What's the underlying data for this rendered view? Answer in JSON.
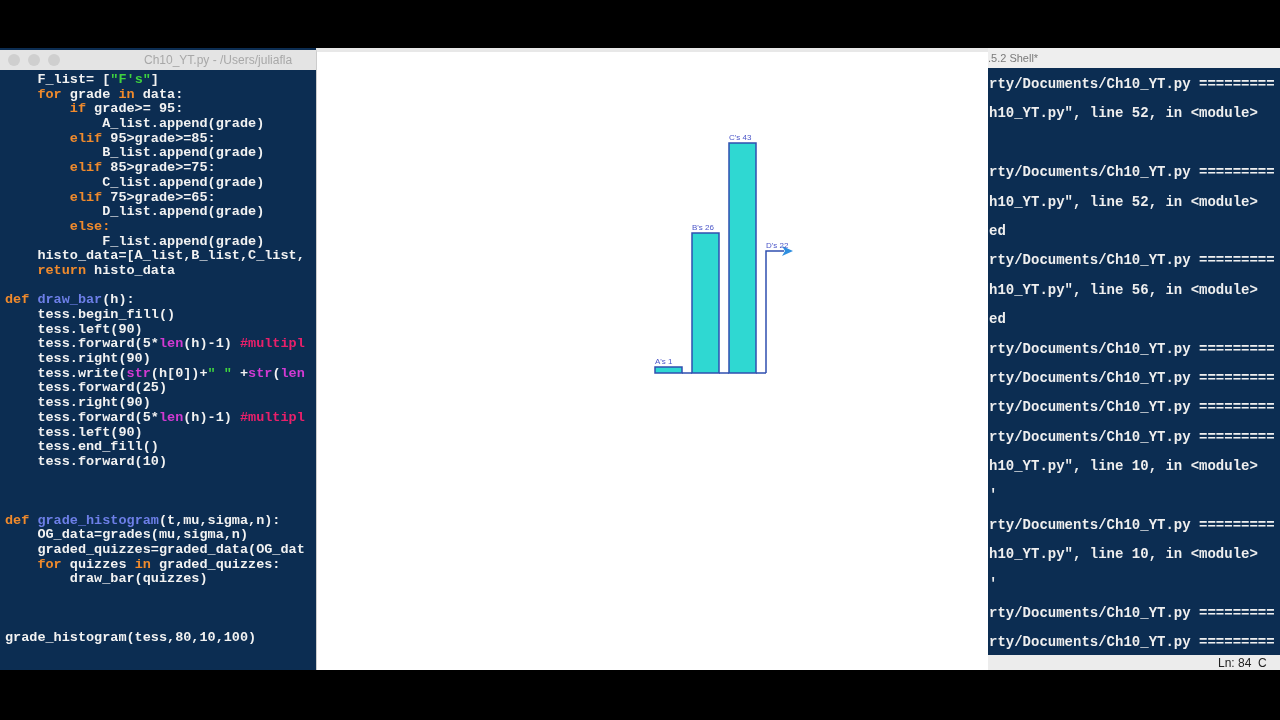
{
  "editor": {
    "title": "Ch10_YT.py - /Users/juliafla",
    "lines": [
      {
        "kind": "code",
        "tokens": [
          {
            "kind": "plain",
            "text": "    F_list= ["
          },
          {
            "kind": "string",
            "text": "\"F's\""
          },
          {
            "kind": "plain",
            "text": "]"
          }
        ]
      },
      {
        "kind": "code",
        "tokens": [
          {
            "kind": "keyword",
            "text": "    for"
          },
          {
            "kind": "plain",
            "text": " grade "
          },
          {
            "kind": "keyword",
            "text": "in"
          },
          {
            "kind": "plain",
            "text": " data:"
          }
        ]
      },
      {
        "kind": "code",
        "tokens": [
          {
            "kind": "keyword",
            "text": "        if"
          },
          {
            "kind": "plain",
            "text": " grade>= 95:"
          }
        ]
      },
      {
        "kind": "code",
        "tokens": [
          {
            "kind": "plain",
            "text": "            A_list.append(grade)"
          }
        ]
      },
      {
        "kind": "code",
        "tokens": [
          {
            "kind": "keyword",
            "text": "        elif"
          },
          {
            "kind": "plain",
            "text": " 95>grade>=85:"
          }
        ]
      },
      {
        "kind": "code",
        "tokens": [
          {
            "kind": "plain",
            "text": "            B_list.append(grade)"
          }
        ]
      },
      {
        "kind": "code",
        "tokens": [
          {
            "kind": "keyword",
            "text": "        elif"
          },
          {
            "kind": "plain",
            "text": " 85>grade>=75:"
          }
        ]
      },
      {
        "kind": "code",
        "tokens": [
          {
            "kind": "plain",
            "text": "            C_list.append(grade)"
          }
        ]
      },
      {
        "kind": "code",
        "tokens": [
          {
            "kind": "keyword",
            "text": "        elif"
          },
          {
            "kind": "plain",
            "text": " 75>grade>=65:"
          }
        ]
      },
      {
        "kind": "code",
        "tokens": [
          {
            "kind": "plain",
            "text": "            D_list.append(grade)"
          }
        ]
      },
      {
        "kind": "code",
        "tokens": [
          {
            "kind": "keyword",
            "text": "        else:"
          }
        ]
      },
      {
        "kind": "code",
        "tokens": [
          {
            "kind": "plain",
            "text": "            F_list.append(grade)"
          }
        ]
      },
      {
        "kind": "code",
        "tokens": [
          {
            "kind": "plain",
            "text": "    histo_data=[A_list,B_list,C_list,"
          }
        ]
      },
      {
        "kind": "code",
        "tokens": [
          {
            "kind": "keyword",
            "text": "    return"
          },
          {
            "kind": "plain",
            "text": " histo_data"
          }
        ]
      },
      {
        "kind": "blank"
      },
      {
        "kind": "code",
        "tokens": [
          {
            "kind": "keyword",
            "text": "def"
          },
          {
            "kind": "defname",
            "text": " draw_bar"
          },
          {
            "kind": "plain",
            "text": "(h):"
          }
        ]
      },
      {
        "kind": "code",
        "tokens": [
          {
            "kind": "plain",
            "text": "    tess.begin_fill()"
          }
        ]
      },
      {
        "kind": "code",
        "tokens": [
          {
            "kind": "plain",
            "text": "    tess.left(90)"
          }
        ]
      },
      {
        "kind": "code",
        "tokens": [
          {
            "kind": "plain",
            "text": "    tess.forward(5*"
          },
          {
            "kind": "builtin",
            "text": "len"
          },
          {
            "kind": "plain",
            "text": "(h)-1) "
          },
          {
            "kind": "comment",
            "text": "#multipl"
          }
        ]
      },
      {
        "kind": "code",
        "tokens": [
          {
            "kind": "plain",
            "text": "    tess.right(90)"
          }
        ]
      },
      {
        "kind": "code",
        "tokens": [
          {
            "kind": "plain",
            "text": "    tess.write("
          },
          {
            "kind": "builtin",
            "text": "str"
          },
          {
            "kind": "plain",
            "text": "(h[0])+"
          },
          {
            "kind": "string",
            "text": "\" \""
          },
          {
            "kind": "plain",
            "text": " +"
          },
          {
            "kind": "builtin",
            "text": "str"
          },
          {
            "kind": "plain",
            "text": "("
          },
          {
            "kind": "builtin",
            "text": "len"
          }
        ]
      },
      {
        "kind": "code",
        "tokens": [
          {
            "kind": "plain",
            "text": "    tess.forward(25)"
          }
        ]
      },
      {
        "kind": "code",
        "tokens": [
          {
            "kind": "plain",
            "text": "    tess.right(90)"
          }
        ]
      },
      {
        "kind": "code",
        "tokens": [
          {
            "kind": "plain",
            "text": "    tess.forward(5*"
          },
          {
            "kind": "builtin",
            "text": "len"
          },
          {
            "kind": "plain",
            "text": "(h)-1) "
          },
          {
            "kind": "comment",
            "text": "#multipl"
          }
        ]
      },
      {
        "kind": "code",
        "tokens": [
          {
            "kind": "plain",
            "text": "    tess.left(90)"
          }
        ]
      },
      {
        "kind": "code",
        "tokens": [
          {
            "kind": "plain",
            "text": "    tess.end_fill()"
          }
        ]
      },
      {
        "kind": "code",
        "tokens": [
          {
            "kind": "plain",
            "text": "    tess.forward(10)"
          }
        ]
      },
      {
        "kind": "blank"
      },
      {
        "kind": "blank"
      },
      {
        "kind": "blank"
      },
      {
        "kind": "code",
        "tokens": [
          {
            "kind": "keyword",
            "text": "def"
          },
          {
            "kind": "defname",
            "text": " grade_histogram"
          },
          {
            "kind": "plain",
            "text": "(t,mu,sigma,n):"
          }
        ]
      },
      {
        "kind": "code",
        "tokens": [
          {
            "kind": "plain",
            "text": "    OG_data=grades(mu,sigma,n)"
          }
        ]
      },
      {
        "kind": "code",
        "tokens": [
          {
            "kind": "plain",
            "text": "    graded_quizzes=graded_data(OG_dat"
          }
        ]
      },
      {
        "kind": "code",
        "tokens": [
          {
            "kind": "keyword",
            "text": "    for"
          },
          {
            "kind": "plain",
            "text": " quizzes "
          },
          {
            "kind": "keyword",
            "text": "in"
          },
          {
            "kind": "plain",
            "text": " graded_quizzes:"
          }
        ]
      },
      {
        "kind": "code",
        "tokens": [
          {
            "kind": "plain",
            "text": "        draw_bar(quizzes)"
          }
        ]
      },
      {
        "kind": "blank"
      },
      {
        "kind": "blank"
      },
      {
        "kind": "blank"
      },
      {
        "kind": "code",
        "tokens": [
          {
            "kind": "plain",
            "text": "grade_histogram(tess,80,10,100)"
          }
        ]
      }
    ]
  },
  "turtle_canvas": {
    "last_bar_unfinished": true,
    "bar_labels": [
      "A's 1",
      "B's 26",
      "C's 43",
      "D's 22"
    ]
  },
  "shell": {
    "title": ".5.2 Shell*",
    "status": "Ln: 84  C",
    "lines": [
      "rty/Documents/Ch10_YT.py =========",
      "h10_YT.py\", line 52, in <module>",
      {
        "kind": "blank"
      },
      "rty/Documents/Ch10_YT.py =========",
      "h10_YT.py\", line 52, in <module>",
      "ed",
      "rty/Documents/Ch10_YT.py =========",
      "h10_YT.py\", line 56, in <module>",
      "ed",
      "rty/Documents/Ch10_YT.py =========",
      "rty/Documents/Ch10_YT.py =========",
      "rty/Documents/Ch10_YT.py =========",
      "rty/Documents/Ch10_YT.py =========",
      "h10_YT.py\", line 10, in <module>",
      "'",
      "rty/Documents/Ch10_YT.py =========",
      "h10_YT.py\", line 10, in <module>",
      "'",
      "rty/Documents/Ch10_YT.py =========",
      "rty/Documents/Ch10_YT.py ========="
    ]
  }
}
